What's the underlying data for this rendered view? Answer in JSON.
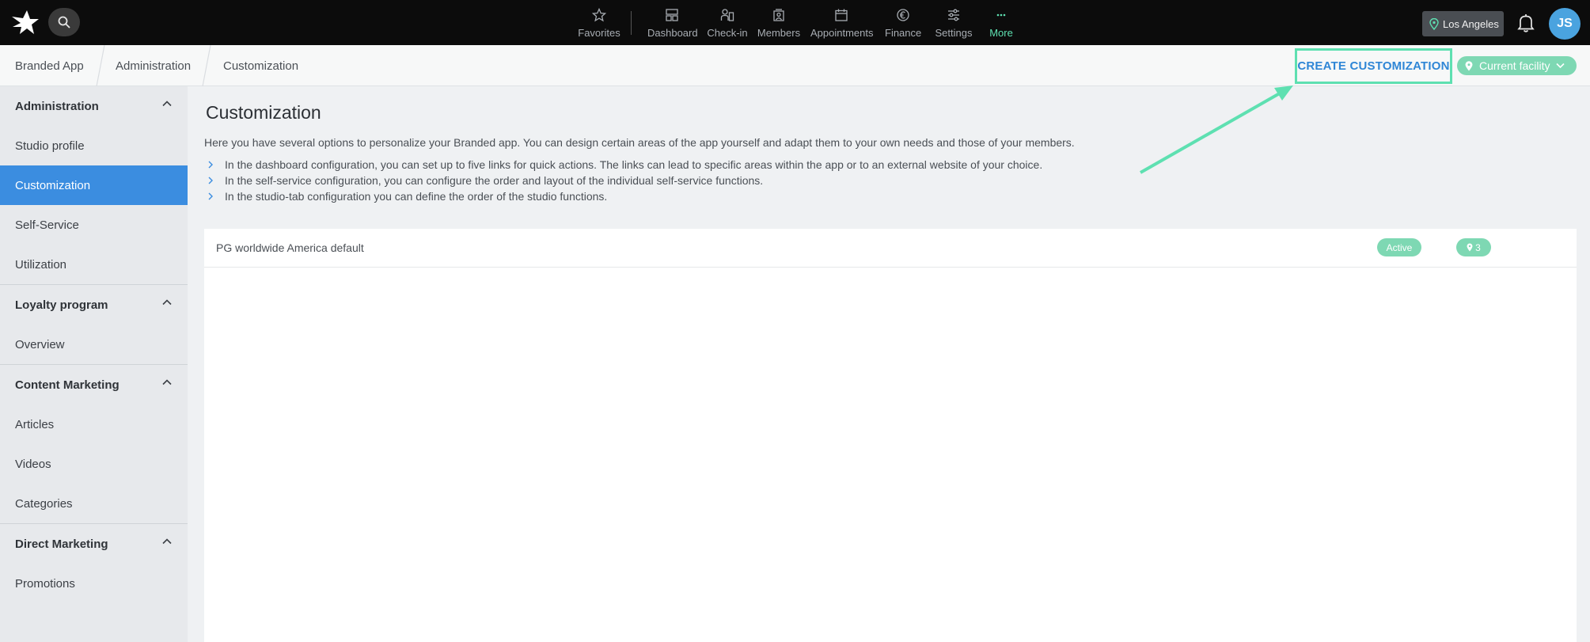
{
  "topbar": {
    "nav": [
      {
        "label": "Favorites",
        "icon": "star-icon"
      },
      {
        "label": "Dashboard",
        "icon": "dashboard-icon"
      },
      {
        "label": "Check-in",
        "icon": "check-in-icon"
      },
      {
        "label": "Members",
        "icon": "members-icon"
      },
      {
        "label": "Appointments",
        "icon": "calendar-icon"
      },
      {
        "label": "Finance",
        "icon": "euro-icon"
      },
      {
        "label": "Settings",
        "icon": "sliders-icon"
      },
      {
        "label": "More",
        "icon": "more-icon"
      }
    ],
    "location": "Los Angeles",
    "avatar_initials": "JS",
    "accent": "#5ee0b1"
  },
  "breadcrumb": [
    "Branded App",
    "Administration",
    "Customization"
  ],
  "actions": {
    "create_label": "CREATE CUSTOMIZATION",
    "facility_label": "Current facility"
  },
  "sidebar": {
    "sections": [
      {
        "title": "Administration",
        "items": [
          "Studio profile",
          "Customization",
          "Self-Service",
          "Utilization"
        ]
      },
      {
        "title": "Loyalty program",
        "items": [
          "Overview"
        ]
      },
      {
        "title": "Content Marketing",
        "items": [
          "Articles",
          "Videos",
          "Categories"
        ]
      },
      {
        "title": "Direct Marketing",
        "items": [
          "Promotions"
        ]
      }
    ],
    "active_item": "Customization"
  },
  "main": {
    "title": "Customization",
    "intro": "Here you have several options to personalize your Branded app. You can design certain areas of the app yourself and adapt them to your own needs and those of your members.",
    "bullets": [
      "In the dashboard configuration, you can set up to five links for quick actions. The links can lead to specific areas within the app or to an external website of your choice.",
      "In the self-service configuration, you can configure the order and layout of the individual self-service functions.",
      "In the studio-tab configuration you can define the order of the studio functions."
    ],
    "rows": [
      {
        "name": "PG worldwide America default",
        "status": "Active",
        "locations": "3"
      }
    ]
  }
}
